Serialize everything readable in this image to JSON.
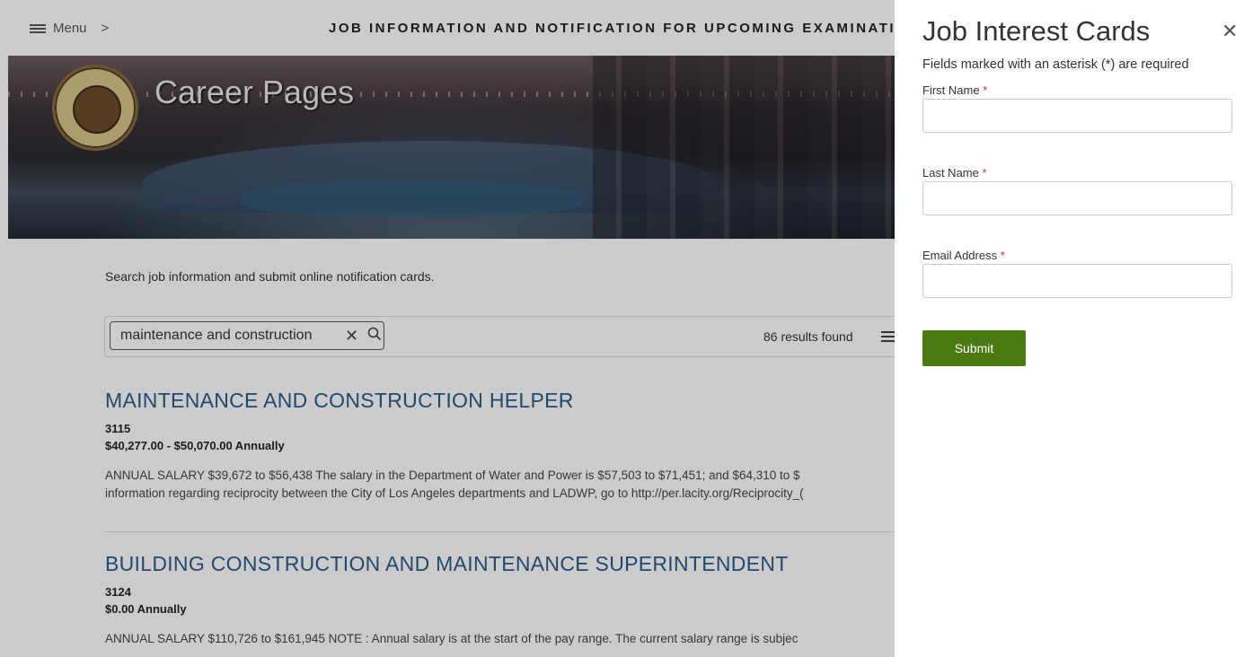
{
  "header": {
    "menu_label": "Menu",
    "chevron": ">",
    "page_heading": "JOB INFORMATION AND NOTIFICATION FOR UPCOMING EXAMINATIONS"
  },
  "banner": {
    "title": "Career Pages",
    "seal_text": "CITY OF LOS ANGELES FOUNDED 1781"
  },
  "main": {
    "intro": "Search job information and submit online notification cards.",
    "search": {
      "value": "maintenance and construction",
      "clear_glyph": "✕",
      "search_glyph": "⚲"
    },
    "results_count": "86 results found",
    "jobs": [
      {
        "title": "MAINTENANCE AND CONSTRUCTION HELPER",
        "code": "3115",
        "salary": "$40,277.00 - $50,070.00 Annually",
        "desc_line1": "ANNUAL SALARY  $39,672 to $56,438 The salary in the Department of Water and Power is $57,503 to $71,451; and $64,310 to $",
        "desc_line2": "information regarding reciprocity between the City of Los Angeles departments and LADWP, go to http://per.lacity.org/Reciprocity_("
      },
      {
        "title": "BUILDING CONSTRUCTION AND MAINTENANCE SUPERINTENDENT",
        "code": "3124",
        "salary": "$0.00 Annually",
        "desc_line1": "ANNUAL SALARY  $110,726 to $161,945 NOTE :  Annual salary is at the start of the pay range. The current salary range is subjec"
      }
    ]
  },
  "panel": {
    "title": "Job Interest Cards",
    "close_glyph": "✕",
    "required_note": "Fields marked with an asterisk (*) are required",
    "asterisk": "*",
    "first_name_label": "First Name",
    "last_name_label": "Last Name",
    "email_label": "Email Address",
    "first_name_value": "",
    "last_name_value": "",
    "email_value": "",
    "submit_label": "Submit"
  },
  "colors": {
    "link_blue": "#2a5b8a",
    "submit_green": "#4c7a12",
    "required_red": "#c0392b"
  }
}
